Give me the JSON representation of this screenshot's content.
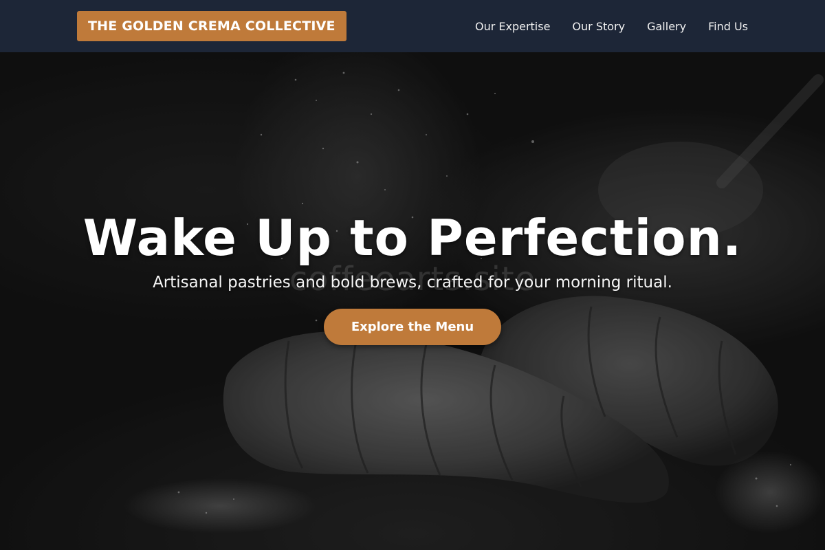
{
  "nav": {
    "brand": "THE GOLDEN CREMA COLLECTIVE",
    "links": [
      "Our Expertise",
      "Our Story",
      "Gallery",
      "Find Us"
    ]
  },
  "hero": {
    "watermark": "coffeearts.site",
    "title": "Wake Up to Perfection.",
    "subtitle": "Artisanal pastries and bold brews, crafted for your morning ritual.",
    "cta_label": "Explore the Menu",
    "background_image": "croissants-dusted-with-flour-photo"
  },
  "colors": {
    "navbar_bg": "#1d2637",
    "accent": "#bf7a3a",
    "text": "#ffffff"
  }
}
